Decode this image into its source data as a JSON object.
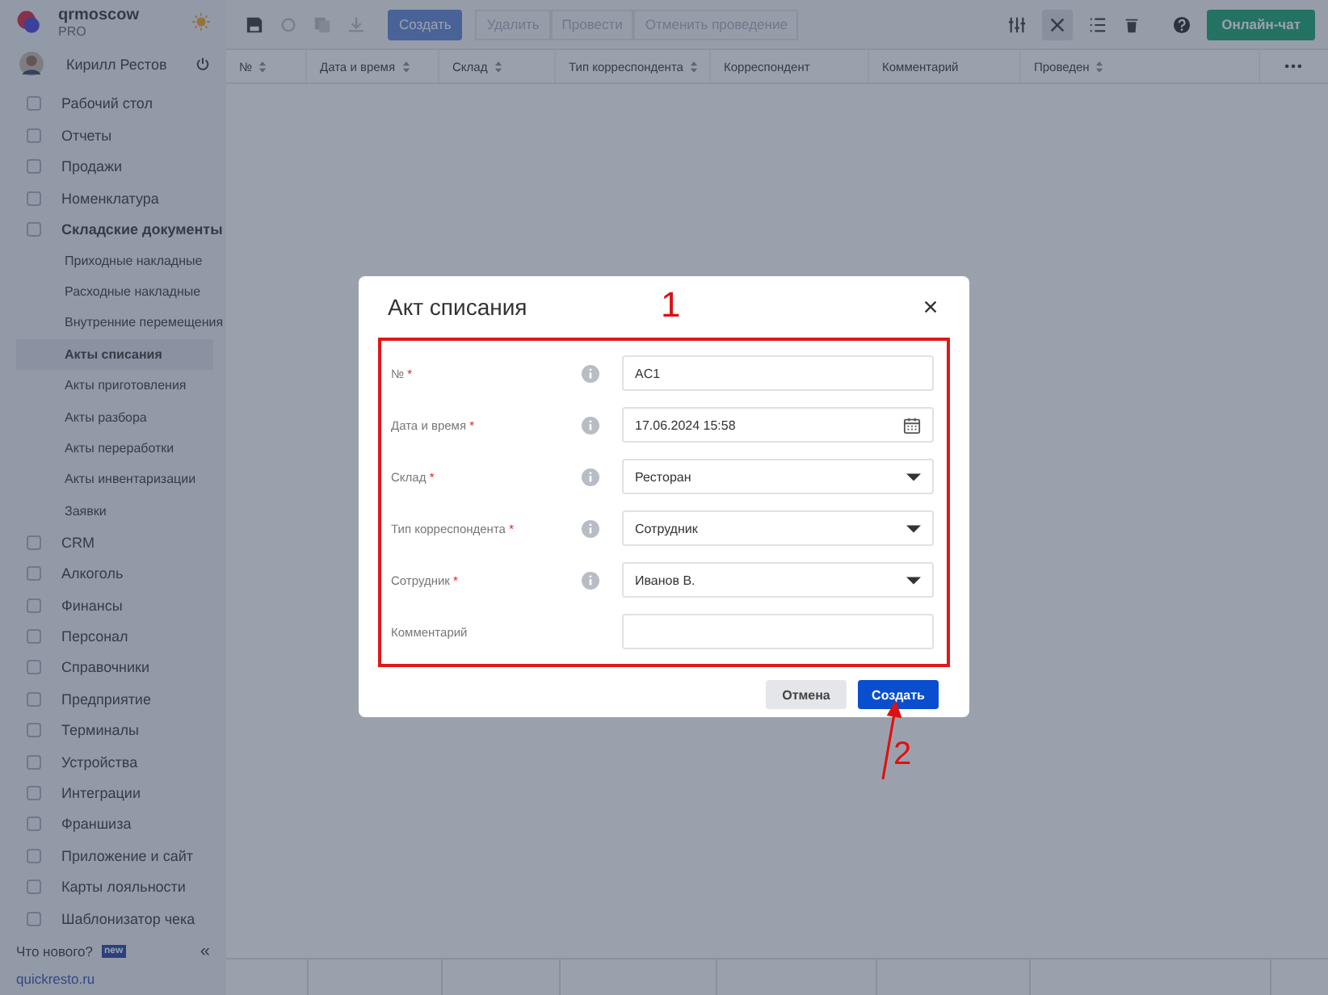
{
  "brand": {
    "name": "qrmoscow",
    "plan": "PRO"
  },
  "user": {
    "name": "Кирилл Рестов"
  },
  "sidebar": {
    "items": [
      {
        "label": "Рабочий стол",
        "expanded": false,
        "selected": false
      },
      {
        "label": "Отчеты",
        "expanded": false,
        "selected": false
      },
      {
        "label": "Продажи",
        "expanded": false,
        "selected": false
      },
      {
        "label": "Номенклатура",
        "expanded": false,
        "selected": false
      },
      {
        "label": "Складские документы",
        "expanded": true,
        "selected": false,
        "children": [
          {
            "label": "Приходные накладные",
            "selected": false
          },
          {
            "label": "Расходные накладные",
            "selected": false
          },
          {
            "label": "Внутренние перемещения",
            "selected": false
          },
          {
            "label": "Акты списания",
            "selected": true
          },
          {
            "label": "Акты приготовления",
            "selected": false
          },
          {
            "label": "Акты разбора",
            "selected": false
          },
          {
            "label": "Акты переработки",
            "selected": false
          },
          {
            "label": "Акты инвентаризации",
            "selected": false
          },
          {
            "label": "Заявки",
            "selected": false
          }
        ]
      },
      {
        "label": "CRM",
        "expanded": false,
        "selected": false
      },
      {
        "label": "Алкоголь",
        "expanded": false,
        "selected": false
      },
      {
        "label": "Финансы",
        "expanded": false,
        "selected": false
      },
      {
        "label": "Персонал",
        "expanded": false,
        "selected": false
      },
      {
        "label": "Справочники",
        "expanded": false,
        "selected": false
      },
      {
        "label": "Предприятие",
        "expanded": false,
        "selected": false
      },
      {
        "label": "Терминалы",
        "expanded": false,
        "selected": false
      },
      {
        "label": "Устройства",
        "expanded": false,
        "selected": false
      },
      {
        "label": "Интеграции",
        "expanded": false,
        "selected": false
      },
      {
        "label": "Франшиза",
        "expanded": false,
        "selected": false
      },
      {
        "label": "Приложение и сайт",
        "expanded": false,
        "selected": false
      },
      {
        "label": "Карты лояльности",
        "expanded": false,
        "selected": false
      },
      {
        "label": "Шаблонизатор чека",
        "expanded": false,
        "selected": false
      }
    ],
    "whats_new": "Что нового?",
    "new_badge": "new",
    "collapse": "«",
    "site_link": "quickresto.ru"
  },
  "toolbar": {
    "buttons": [
      {
        "label": "Создать",
        "kind": "primary",
        "disabled": false
      },
      {
        "label": "Удалить",
        "kind": "plain",
        "disabled": true
      },
      {
        "label": "Провести",
        "kind": "plain",
        "disabled": true
      },
      {
        "label": "Отменить проведение",
        "kind": "plain",
        "disabled": true
      }
    ],
    "chat_button": "Онлайн-чат"
  },
  "table": {
    "columns": [
      {
        "label": "№",
        "sortable": true
      },
      {
        "label": "Дата и время",
        "sortable": true
      },
      {
        "label": "Склад",
        "sortable": true
      },
      {
        "label": "Тип корреспондента",
        "sortable": true
      },
      {
        "label": "Корреспондент",
        "sortable": false
      },
      {
        "label": "Комментарий",
        "sortable": false
      },
      {
        "label": "Проведен",
        "sortable": true
      }
    ]
  },
  "dialog": {
    "title": "Акт списания",
    "fields": [
      {
        "label": "№",
        "required_mark": "*",
        "info": true,
        "kind": "input",
        "value": "AC1"
      },
      {
        "label": "Дата и время",
        "required_mark": "*",
        "info": true,
        "kind": "date",
        "value": "17.06.2024 15:58"
      },
      {
        "label": "Склад",
        "required_mark": "*",
        "info": true,
        "kind": "select",
        "value": "Ресторан"
      },
      {
        "label": "Тип корреспондента",
        "required_mark": "*",
        "info": true,
        "kind": "select",
        "value": "Сотрудник"
      },
      {
        "label": "Сотрудник",
        "required_mark": "*",
        "info": true,
        "kind": "select",
        "value": "Иванов В."
      },
      {
        "label": "Комментарий",
        "info": false,
        "kind": "input"
      }
    ],
    "cancel_button": "Отмена",
    "create_button": "Создать"
  },
  "annotations": {
    "box_label": "1",
    "arrow_label": "2"
  }
}
